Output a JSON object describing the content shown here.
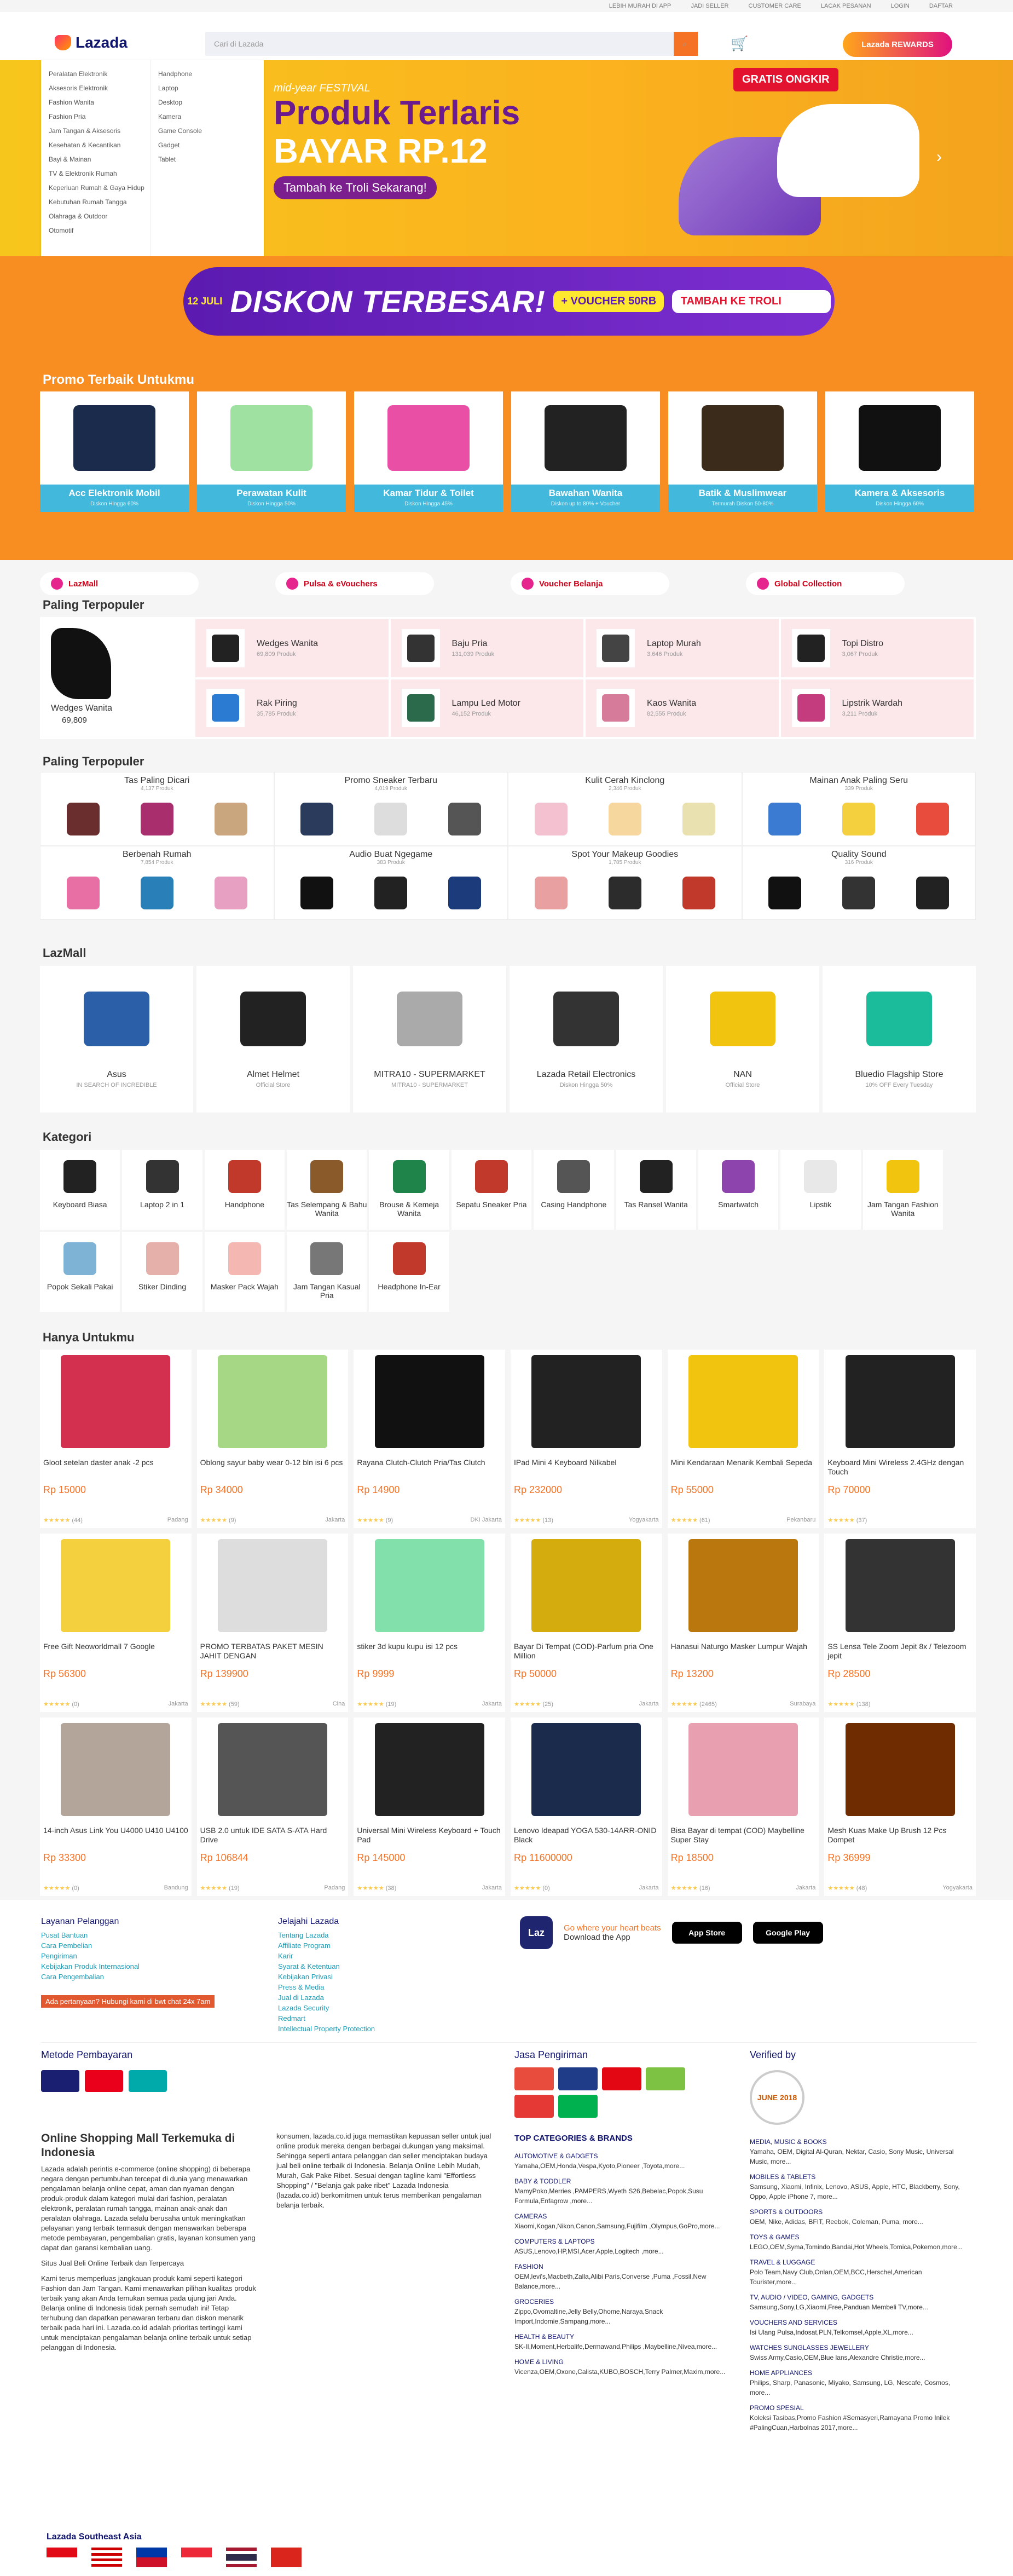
{
  "topbar": {
    "links": [
      "LEBIH MURAH DI APP",
      "JADI SELLER",
      "CUSTOMER CARE",
      "LACAK PESANAN",
      "LOGIN",
      "DAFTAR"
    ]
  },
  "header": {
    "logo": "Lazada",
    "search_placeholder": "Cari di Lazada",
    "rewards": "Lazada REWARDS"
  },
  "catmenu": {
    "left": [
      "Peralatan Elektronik",
      "Aksesoris Elektronik",
      "Fashion Wanita",
      "Fashion Pria",
      "Jam Tangan & Aksesoris",
      "Kesehatan & Kecantikan",
      "Bayi & Mainan",
      "TV & Elektronik Rumah",
      "Keperluan Rumah & Gaya Hidup",
      "Kebutuhan Rumah Tangga",
      "Olahraga & Outdoor",
      "Otomotif"
    ],
    "right": [
      "Handphone",
      "Laptop",
      "Desktop",
      "Kamera",
      "Game Console",
      "Gadget",
      "Tablet"
    ]
  },
  "hero": {
    "t1": "mid-year FESTIVAL",
    "t2": "Produk Terlaris",
    "t3": "BAYAR RP.12",
    "t4": "Tambah ke Troli Sekarang!",
    "badge": "GRATIS ONGKIR"
  },
  "flash": {
    "date": "12 JULI",
    "big": "DISKON TERBESAR!",
    "voucher": "+ VOUCHER 50RB",
    "cta": "TAMBAH KE TROLI"
  },
  "promo": {
    "title": "Promo Terbaik Untukmu",
    "cards": [
      {
        "name": "Acc Elektronik Mobil",
        "sub": "Diskon Hingga 60%",
        "color": "#1b2b4b"
      },
      {
        "name": "Perawatan Kulit",
        "sub": "Diskon Hingga 50%",
        "color": "#9fe1a1"
      },
      {
        "name": "Kamar Tidur & Toilet",
        "sub": "Diskon Hingga 45%",
        "color": "#e84fa5"
      },
      {
        "name": "Bawahan Wanita",
        "sub": "Diskon up to 80% + Voucher",
        "color": "#222"
      },
      {
        "name": "Batik & Muslimwear",
        "sub": "Termurah Diskon 50-80%",
        "color": "#3b2b1b"
      },
      {
        "name": "Kamera & Aksesoris",
        "sub": "Diskon Hingga 60%",
        "color": "#111"
      }
    ]
  },
  "pills": [
    "LazMall",
    "Pulsa & eVouchers",
    "Voucher Belanja",
    "Global Collection"
  ],
  "popular1": {
    "title": "Paling Terpopuler",
    "feature": {
      "name": "Wedges Wanita",
      "count": "69,809"
    },
    "items": [
      {
        "name": "Wedges Wanita",
        "count": "69,809 Produk",
        "color": "#222"
      },
      {
        "name": "Baju Pria",
        "count": "131,039 Produk",
        "color": "#333"
      },
      {
        "name": "Laptop Murah",
        "count": "3,646 Produk",
        "color": "#444"
      },
      {
        "name": "Topi Distro",
        "count": "3,067 Produk",
        "color": "#222"
      },
      {
        "name": "Rak Piring",
        "count": "35,785 Produk",
        "color": "#2a7bd1"
      },
      {
        "name": "Lampu Led Motor",
        "count": "46,152 Produk",
        "color": "#2b6a4b"
      },
      {
        "name": "Kaos Wanita",
        "count": "82,555 Produk",
        "color": "#d67b99"
      },
      {
        "name": "Lipstrik Wardah",
        "count": "3,211 Produk",
        "color": "#c43b7e"
      }
    ]
  },
  "popular2": {
    "title": "Paling Terpopuler",
    "cells": [
      {
        "name": "Tas Paling Dicari",
        "count": "4,137 Produk",
        "c": [
          "#6a2e2e",
          "#a82e6e",
          "#c9a67e"
        ]
      },
      {
        "name": "Promo Sneaker Terbaru",
        "count": "4,019 Produk",
        "c": [
          "#2b3b5b",
          "#ddd",
          "#555"
        ]
      },
      {
        "name": "Kulit Cerah Kinclong",
        "count": "2,346 Produk",
        "c": [
          "#f3c1d0",
          "#f6d89e",
          "#e9e2b0"
        ]
      },
      {
        "name": "Mainan Anak Paling Seru",
        "count": "339 Produk",
        "c": [
          "#3b7bd1",
          "#f4d03f",
          "#e74c3c"
        ]
      },
      {
        "name": "Berbenah Rumah",
        "count": "7,854 Produk",
        "c": [
          "#e76fa3",
          "#2980b9",
          "#e8a0c2"
        ]
      },
      {
        "name": "Audio Buat Ngegame",
        "count": "383 Produk",
        "c": [
          "#111",
          "#222",
          "#1b3b7b"
        ]
      },
      {
        "name": "Spot Your Makeup Goodies",
        "count": "1,785 Produk",
        "c": [
          "#e8a0a0",
          "#2c2c2c",
          "#c0392b"
        ]
      },
      {
        "name": "Quality Sound",
        "count": "316 Produk",
        "c": [
          "#111",
          "#333",
          "#222"
        ]
      }
    ]
  },
  "lazmall": {
    "title": "LazMall",
    "stores": [
      {
        "name": "Asus",
        "sub": "IN SEARCH OF INCREDIBLE",
        "color": "#2b5fa8"
      },
      {
        "name": "Almet Helmet",
        "sub": "Official Store",
        "color": "#222"
      },
      {
        "name": "MITRA10 - SUPERMARKET",
        "sub": "MITRA10 - SUPERMARKET",
        "color": "#aaa"
      },
      {
        "name": "Lazada Retail Electronics",
        "sub": "Diskon Hingga 50%",
        "color": "#333"
      },
      {
        "name": "NAN",
        "sub": "Official Store",
        "color": "#f1c40f"
      },
      {
        "name": "Bluedio Flagship Store",
        "sub": "10% OFF Every Tuesday",
        "color": "#1abc9c"
      }
    ]
  },
  "kategori": {
    "title": "Kategori",
    "items": [
      {
        "name": "Keyboard Biasa",
        "color": "#222"
      },
      {
        "name": "Laptop 2 in 1",
        "color": "#333"
      },
      {
        "name": "Handphone",
        "color": "#c0392b"
      },
      {
        "name": "Tas Selempang & Bahu Wanita",
        "color": "#8b5a2b"
      },
      {
        "name": "Brouse & Kemeja Wanita",
        "color": "#1e8449"
      },
      {
        "name": "Sepatu Sneaker Pria",
        "color": "#c0392b"
      },
      {
        "name": "Casing Handphone",
        "color": "#555"
      },
      {
        "name": "Tas Ransel Wanita",
        "color": "#222"
      },
      {
        "name": "Smartwatch",
        "color": "#8e44ad"
      },
      {
        "name": "Lipstik",
        "color": "#e8e8e8"
      },
      {
        "name": "Jam Tangan Fashion Wanita",
        "color": "#f1c40f"
      },
      {
        "name": "Popok Sekali Pakai",
        "color": "#7fb3d5"
      },
      {
        "name": "Stiker Dinding",
        "color": "#e6b0aa"
      },
      {
        "name": "Masker Pack Wajah",
        "color": "#f5b7b1"
      },
      {
        "name": "Jam Tangan Kasual Pria",
        "color": "#777"
      },
      {
        "name": "Headphone In-Ear",
        "color": "#c0392b"
      }
    ]
  },
  "hanya": {
    "title": "Hanya Untukmu",
    "items": [
      {
        "name": "Gloot setelan daster anak -2 pcs",
        "price": "Rp 15000",
        "reviews": "(44)",
        "loc": "Padang",
        "color": "#d32f4f"
      },
      {
        "name": "Oblong sayur baby wear 0-12 bln isi 6 pcs",
        "price": "Rp 34000",
        "reviews": "(9)",
        "loc": "Jakarta",
        "color": "#a6d785"
      },
      {
        "name": "Rayana Clutch-Clutch Pria/Tas Clutch",
        "price": "Rp 14900",
        "reviews": "(9)",
        "loc": "DKI Jakarta",
        "color": "#111"
      },
      {
        "name": "IPad Mini 4 Keyboard Nilkabel",
        "price": "Rp 232000",
        "reviews": "(13)",
        "loc": "Yogyakarta",
        "color": "#222"
      },
      {
        "name": "Mini Kendaraan Menarik Kembali Sepeda",
        "price": "Rp 55000",
        "reviews": "(61)",
        "loc": "Pekanbaru",
        "color": "#f1c40f"
      },
      {
        "name": "Keyboard Mini Wireless 2.4GHz dengan Touch",
        "price": "Rp 70000",
        "reviews": "(37)",
        "loc": "",
        "color": "#222"
      },
      {
        "name": "Free Gift Neoworldmall 7 Google",
        "price": "Rp 56300",
        "reviews": "(0)",
        "loc": "Jakarta",
        "color": "#f4d03f"
      },
      {
        "name": "PROMO TERBATAS PAKET MESIN JAHIT DENGAN",
        "price": "Rp 139900",
        "reviews": "(59)",
        "loc": "Cina",
        "color": "#ddd"
      },
      {
        "name": "stiker 3d kupu kupu isi 12 pcs",
        "price": "Rp 9999",
        "reviews": "(19)",
        "loc": "Jakarta",
        "color": "#82e0aa"
      },
      {
        "name": "Bayar Di Tempat (COD)-Parfum pria One Million",
        "price": "Rp 50000",
        "reviews": "(25)",
        "loc": "Jakarta",
        "color": "#d4ac0d"
      },
      {
        "name": "Hanasui Naturgo Masker Lumpur Wajah",
        "price": "Rp 13200",
        "reviews": "(2465)",
        "loc": "Surabaya",
        "color": "#b9770e"
      },
      {
        "name": "SS Lensa Tele Zoom Jepit 8x / Telezoom jepit",
        "price": "Rp 28500",
        "reviews": "(138)",
        "loc": "",
        "color": "#333"
      },
      {
        "name": "14-inch Asus Link You U4000 U410 U4100",
        "price": "Rp 33300",
        "reviews": "(0)",
        "loc": "Bandung",
        "color": "#b3a59a"
      },
      {
        "name": "USB 2.0 untuk IDE SATA S-ATA Hard Drive",
        "price": "Rp 106844",
        "reviews": "(19)",
        "loc": "Padang",
        "color": "#555"
      },
      {
        "name": "Universal Mini Wireless Keyboard + Touch Pad",
        "price": "Rp 145000",
        "reviews": "(38)",
        "loc": "Jakarta",
        "color": "#222"
      },
      {
        "name": "Lenovo Ideapad YOGA 530-14ARR-ONID Black",
        "price": "Rp 11600000",
        "reviews": "(0)",
        "loc": "Jakarta",
        "color": "#1b2b4b"
      },
      {
        "name": "Bisa Bayar di tempat (COD) Maybelline Super Stay",
        "price": "Rp 18500",
        "reviews": "(16)",
        "loc": "Jakarta",
        "color": "#e8a0b0"
      },
      {
        "name": "Mesh Kuas Make Up Brush 12 Pcs Dompet",
        "price": "Rp 36999",
        "reviews": "(48)",
        "loc": "Yogyakarta",
        "color": "#6e2c00"
      }
    ]
  },
  "footer": {
    "layanan_title": "Layanan Pelanggan",
    "layanan": [
      "Pusat Bantuan",
      "Cara Pembelian",
      "Pengiriman",
      "Kebijakan Produk Internasional",
      "Cara Pengembalian"
    ],
    "jelajahi_title": "Jelajahi Lazada",
    "jelajahi": [
      "Tentang Lazada",
      "Affiliate Program",
      "Karir",
      "Syarat & Ketentuan",
      "Kebijakan Privasi",
      "Press & Media",
      "Jual di Lazada",
      "Lazada Security",
      "Redmart",
      "Intellectual Property Protection"
    ],
    "alert": "Ada pertanyaan? Hubungi kami di bwt chat 24x 7am",
    "app_a": "Go where your heart beats",
    "app_b": "Download the App",
    "app_store": "App Store",
    "google_play": "Google Play",
    "payment_title": "Metode Pembayaran",
    "shipping_title": "Jasa Pengiriman",
    "verified_title": "Verified by",
    "verified_badge": "JUNE 2018",
    "about_title": "Online Shopping Mall Terkemuka di Indonesia",
    "about_p1": "Lazada adalah perintis e-commerce (online shopping) di beberapa negara dengan pertumbuhan tercepat di dunia yang menawarkan pengalaman belanja online cepat, aman dan nyaman dengan produk-produk dalam kategori mulai dari fashion, peralatan elektronik, peralatan rumah tangga, mainan anak-anak dan peralatan olahraga. Lazada selalu berusaha untuk meningkatkan pelayanan yang terbaik termasuk dengan menawarkan beberapa metode pembayaran, pengembalian gratis, layanan konsumen yang dapat dan garansi kembalian uang.",
    "about_p2": "Situs Jual Beli Online Terbaik dan Terpercaya",
    "about_p3": "Kami terus memperluas jangkauan produk kami seperti kategori Fashion dan Jam Tangan. Kami menawarkan pilihan kualitas produk terbaik yang akan Anda temukan semua pada ujung jari Anda. Belanja online di Indonesia tidak pernah semudah ini! Tetap terhubung dan dapatkan penawaran terbaru dan diskon menarik terbaik pada hari ini. Lazada.co.id adalah prioritas tertinggi kami untuk menciptakan pengalaman belanja online terbaik untuk setiap pelanggan di Indonesia.",
    "about_c2": "konsumen, lazada.co.id juga memastikan kepuasan seller untuk jual online produk mereka dengan berbagai dukungan yang maksimal. Sehingga seperti antara pelanggan dan seller menciptakan budaya jual beli online terbaik di Indonesia. Belanja Online Lebih Mudah, Murah, Gak Pake Ribet. Sesuai dengan tagline kami \"Effortless Shopping\" / \"Belanja gak pake ribet\" Lazada Indonesia (lazada.co.id) berkomitmen untuk terus memberikan pengalaman belanja terbaik.",
    "cats_title": "TOP CATEGORIES & BRANDS",
    "cats": [
      {
        "h": "AUTOMOTIVE & GADGETS",
        "t": "Yamaha,OEM,Honda,Vespa,Kyoto,Pioneer ,Toyota,more..."
      },
      {
        "h": "BABY & TODDLER",
        "t": "MamyPoko,Merries ,PAMPERS,Wyeth S26,Bebelac,Popok,Susu Formula,Enfagrow ,more..."
      },
      {
        "h": "CAMERAS",
        "t": "Xiaomi,Kogan,Nikon,Canon,Samsung,Fujifilm ,Olympus,GoPro,more..."
      },
      {
        "h": "COMPUTERS & LAPTOPS",
        "t": "ASUS,Lenovo,HP,MSI,Acer,Apple,Logitech ,more..."
      },
      {
        "h": "FASHION",
        "t": "OEM,levi's,Macbeth,Zalla,Alibi Paris,Converse ,Puma ,Fossil,New Balance,more..."
      },
      {
        "h": "GROCERIES",
        "t": "Zippo,Ovomaltine,Jelly Belly,Ohome,Naraya,Snack Import,Indomie,Sampang,more..."
      },
      {
        "h": "HEALTH & BEAUTY",
        "t": "SK-II,Moment,Herbalife,Dermawand,Philips ,Maybelline,Nivea,more..."
      },
      {
        "h": "HOME & LIVING",
        "t": "Vicenza,OEM,Oxone,Calista,KUBO,BOSCH,Terry Palmer,Maxim,more..."
      }
    ],
    "cats2": [
      {
        "h": "MEDIA, MUSIC & BOOKS",
        "t": "Yamaha, OEM, Digital Al-Quran, Nektar, Casio, Sony Music, Universal Music, more..."
      },
      {
        "h": "MOBILES & TABLETS",
        "t": "Samsung, Xiaomi, Infinix, Lenovo, ASUS, Apple, HTC, Blackberry, Sony, Oppo, Apple iPhone 7, more..."
      },
      {
        "h": "SPORTS & OUTDOORS",
        "t": "OEM, Nike, Adidas, BFIT, Reebok, Coleman, Puma, more..."
      },
      {
        "h": "TOYS & GAMES",
        "t": "LEGO,OEM,Syma,Tomindo,Bandai,Hot Wheels,Tomica,Pokemon,more..."
      },
      {
        "h": "TRAVEL & LUGGAGE",
        "t": "Polo Team,Navy Club,Onlan,OEM,BCC,Herschel,American Tourister,more..."
      },
      {
        "h": "TV, AUDIO / VIDEO, GAMING, GADGETS",
        "t": "Samsung,Sony,LG,Xiaomi,Free,Panduan Membeli TV,more..."
      },
      {
        "h": "VOUCHERS AND SERVICES",
        "t": "Isi Ulang Pulsa,Indosat,PLN,Telkomsel,Apple,XL,more..."
      },
      {
        "h": "WATCHES SUNGLASSES JEWELLERY",
        "t": "Swiss Army,Casio,OEM,Blue lans,Alexandre Christie,more..."
      },
      {
        "h": "HOME APPLIANCES",
        "t": "Philips, Sharp, Panasonic, Miyako, Samsung, LG, Nescafe, Cosmos, more..."
      },
      {
        "h": "PROMO SPESIAL",
        "t": "Koleksi Tasibas,Promo Fashion #Semasyeri,Ramayana Promo Inilek #PalingCuan,Harbolnas 2017,more..."
      }
    ],
    "sea": "Lazada Southeast Asia"
  },
  "colors": {
    "accent": "#f57224",
    "navy": "#0f146d",
    "orange_bg": "#f88d22",
    "price": "#f57224"
  }
}
